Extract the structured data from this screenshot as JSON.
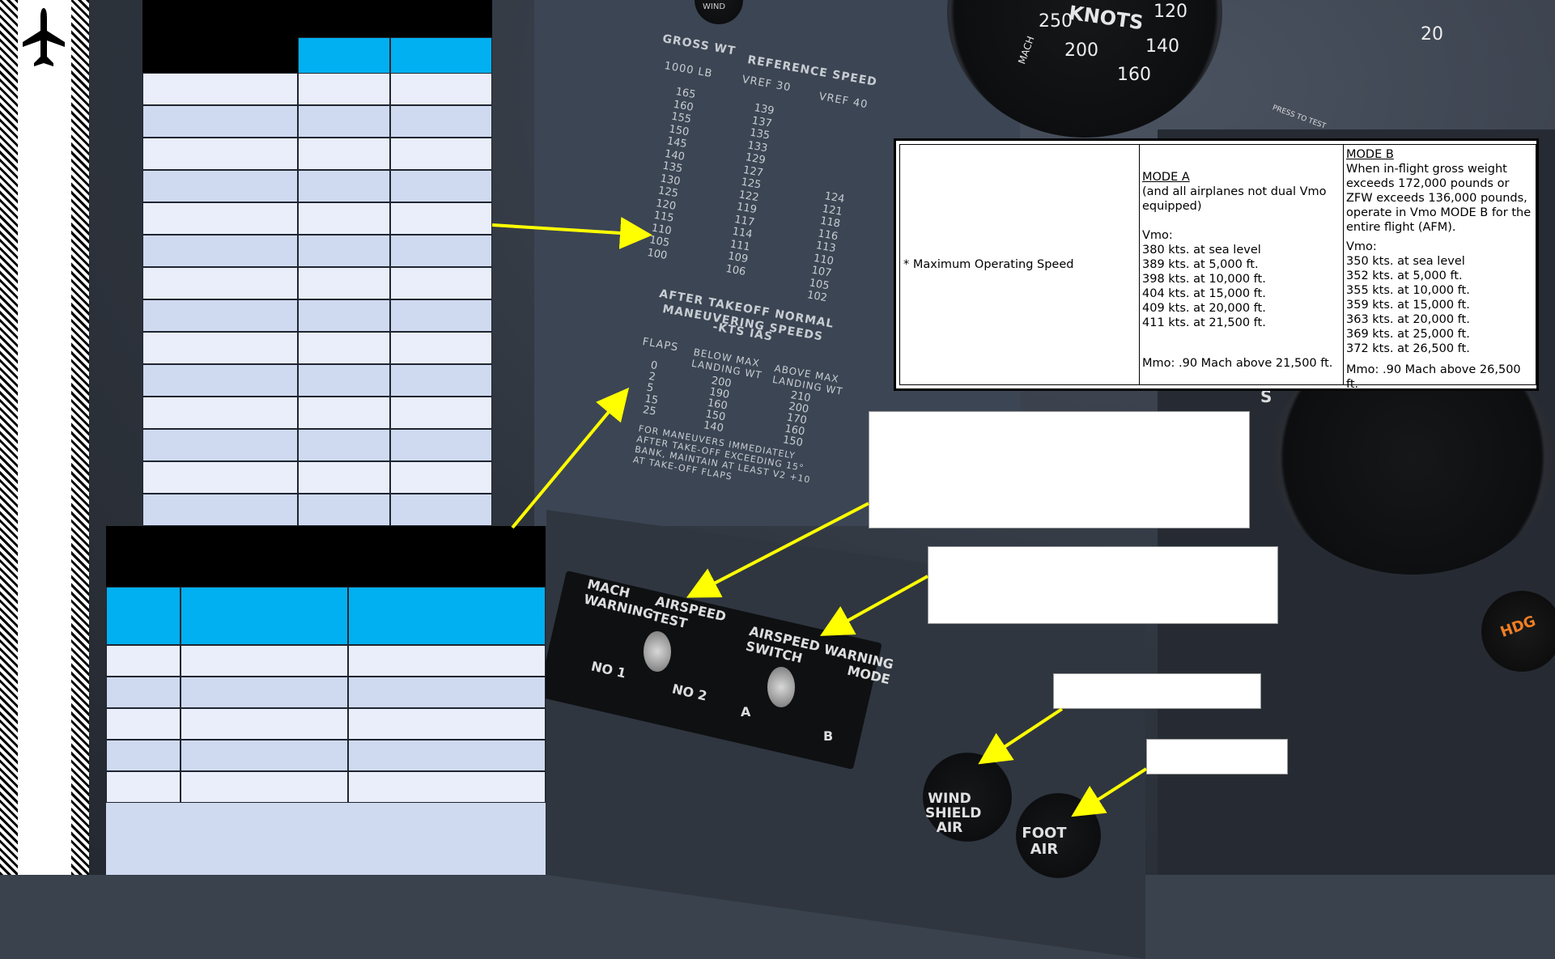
{
  "placard": {
    "gross_wt": "GROSS WT",
    "gross_unit": "1000 LB",
    "ref_speed": "REFERENCE SPEED",
    "vref30": "VREF 30",
    "vref40": "VREF 40",
    "weights": [
      "165",
      "160",
      "155",
      "150",
      "145",
      "140",
      "135",
      "130",
      "125",
      "120",
      "115",
      "110",
      "105",
      "100"
    ],
    "vref30_values": [
      "139",
      "137",
      "135",
      "133",
      "129",
      "127",
      "125",
      "122",
      "119",
      "117",
      "114",
      "111",
      "109",
      "106"
    ],
    "vref40_values": [
      "124",
      "121",
      "118",
      "116",
      "113",
      "110",
      "107",
      "105",
      "102"
    ],
    "after_takeoff": "AFTER TAKEOFF NORMAL",
    "maneuvering": "MANEUVERING SPEEDS",
    "kts_ias": "-KTS IAS",
    "flaps": "FLAPS",
    "below_max": "BELOW MAX LANDING WT",
    "above_max": "ABOVE MAX LANDING WT",
    "flap_values": [
      "0",
      "2",
      "5",
      "15",
      "25"
    ],
    "below_values": [
      "200",
      "190",
      "160",
      "150",
      "140"
    ],
    "above_values": [
      "210",
      "200",
      "170",
      "160",
      "150"
    ],
    "note": "FOR MANEUVERS IMMEDIATELY AFTER TAKE-OFF EXCEEDING 15° BANK, MAINTAIN AT LEAST V2 +10 AT TAKE-OFF FLAPS"
  },
  "switch_panel": {
    "mach_warning": "MACH WARNING",
    "airspeed_test": "AIRSPEED TEST",
    "no1": "NO 1",
    "no2": "NO 2",
    "airspeed_switch": "AIRSPEED SWITCH",
    "warning_mode": "WARNING MODE",
    "a": "A",
    "b": "B"
  },
  "knobs": {
    "windshield_air": "WIND SHIELD AIR",
    "foot_air": "FOOT AIR"
  },
  "gauges": {
    "knots": "KNOTS",
    "mach": "MACH",
    "s_label": "S",
    "hdg": "HDG",
    "press_to_test": "PRESS TO TEST",
    "wind": "WIND",
    "tick_250": "250",
    "tick_200": "200",
    "tick_160": "160",
    "tick_140": "140",
    "tick_120": "120",
    "tick_20": "20"
  },
  "info_table": {
    "row_label": "* Maximum Operating Speed",
    "mode_a": {
      "title": "MODE A",
      "note": "(and all airplanes not dual Vmo equipped)",
      "vmo_label": "Vmo:",
      "lines": [
        "380 kts. at sea level",
        "389 kts. at 5,000 ft.",
        "398 kts. at 10,000 ft.",
        "404 kts. at 15,000 ft.",
        "409 kts. at 20,000 ft.",
        "411 kts. at 21,500 ft."
      ],
      "mmo": "Mmo: .90 Mach above 21,500 ft."
    },
    "mode_b": {
      "title": "MODE B",
      "note": "When in-flight gross weight exceeds 172,000 pounds or ZFW exceeds 136,000 pounds, operate in Vmo MODE B for the entire flight (AFM).",
      "vmo_label": "Vmo:",
      "lines": [
        "350 kts. at sea level",
        "352 kts. at 5,000 ft.",
        "355 kts. at 10,000 ft.",
        "359 kts. at 15,000 ft.",
        "363 kts. at 20,000 ft.",
        "369 kts. at 25,000 ft.",
        "372 kts. at 26,500 ft."
      ],
      "mmo": "Mmo: .90 Mach above 26,500 ft."
    }
  },
  "colors": {
    "accent": "#00b0f0",
    "cell_light": "#e9eefa",
    "cell_mid": "#cfdaf0",
    "arrow": "#ffff00"
  }
}
